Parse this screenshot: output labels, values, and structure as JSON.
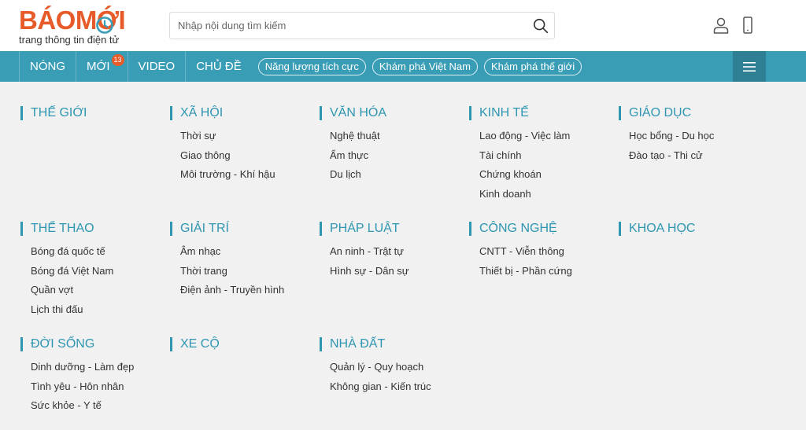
{
  "logo": {
    "text": "BÁOMỚI",
    "tagline": "trang thông tin điện tử",
    "brand_color": "#e65b29"
  },
  "search": {
    "placeholder": "Nhập nội dung tìm kiếm",
    "icon": "search-icon"
  },
  "header_icons": {
    "user": "user-icon",
    "mobile": "mobile-icon"
  },
  "nav": {
    "items": [
      {
        "label": "NÓNG"
      },
      {
        "label": "MỚI",
        "badge": "13"
      },
      {
        "label": "VIDEO"
      },
      {
        "label": "CHỦ ĐỀ"
      }
    ],
    "pills": [
      "Năng lượng tích cực",
      "Khám phá Việt Nam",
      "Khám phá thế giới"
    ],
    "menu_icon": "hamburger-icon",
    "color": "#3a9db6"
  },
  "categories": [
    {
      "title": "THẾ GIỚI",
      "items": []
    },
    {
      "title": "XÃ HỘI",
      "items": [
        "Thời sự",
        "Giao thông",
        "Môi trường - Khí hậu"
      ]
    },
    {
      "title": "VĂN HÓA",
      "items": [
        "Nghệ thuật",
        "Ẩm thực",
        "Du lịch"
      ]
    },
    {
      "title": "KINH TẾ",
      "items": [
        "Lao động - Việc làm",
        "Tài chính",
        "Chứng khoán",
        "Kinh doanh"
      ]
    },
    {
      "title": "GIÁO DỤC",
      "items": [
        "Học bổng - Du học",
        "Đào tạo - Thi cử"
      ]
    },
    {
      "title": "THỂ THAO",
      "items": [
        "Bóng đá quốc tế",
        "Bóng đá Việt Nam",
        "Quần vợt",
        "Lịch thi đấu"
      ]
    },
    {
      "title": "GIẢI TRÍ",
      "items": [
        "Âm nhạc",
        "Thời trang",
        "Điện ảnh - Truyền hình"
      ]
    },
    {
      "title": "PHÁP LUẬT",
      "items": [
        "An ninh - Trật tự",
        "Hình sự - Dân sự"
      ]
    },
    {
      "title": "CÔNG NGHỆ",
      "items": [
        "CNTT - Viễn thông",
        "Thiết bị - Phần cứng"
      ]
    },
    {
      "title": "KHOA HỌC",
      "items": []
    },
    {
      "title": "ĐỜI SỐNG",
      "items": [
        "Dinh dưỡng - Làm đẹp",
        "Tình yêu - Hôn nhân",
        "Sức khỏe - Y tế"
      ]
    },
    {
      "title": "XE CỘ",
      "items": []
    },
    {
      "title": "NHÀ ĐẤT",
      "items": [
        "Quản lý - Quy hoạch",
        "Không gian - Kiến trúc"
      ]
    }
  ]
}
